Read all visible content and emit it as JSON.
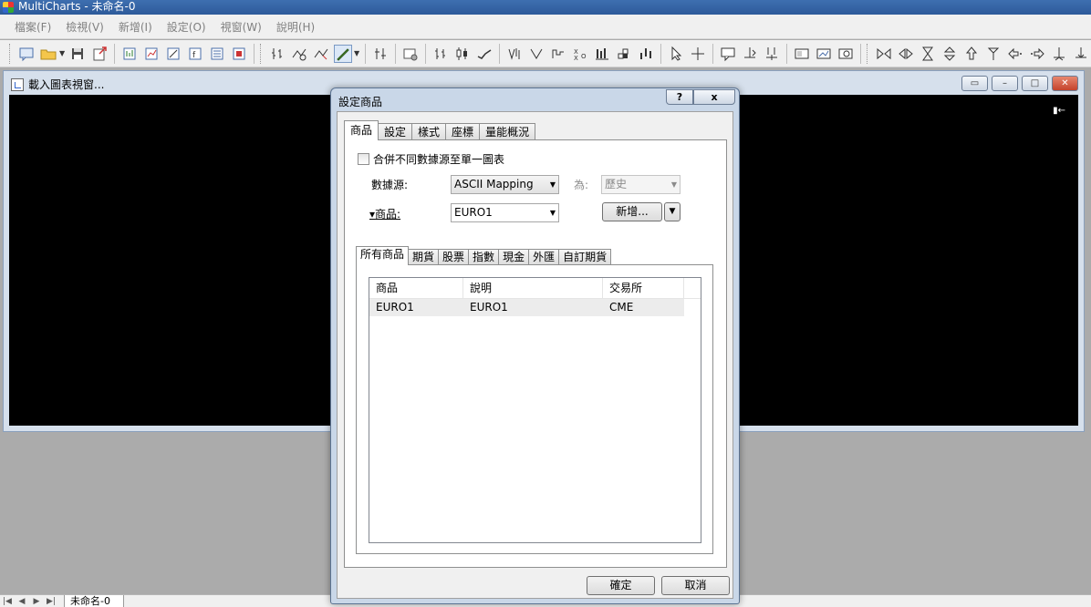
{
  "window": {
    "title": "MultiCharts - 未命名-0"
  },
  "menu": [
    "檔案(F)",
    "檢視(V)",
    "新增(I)",
    "設定(O)",
    "視窗(W)",
    "說明(H)"
  ],
  "chart_window": {
    "title": "載入圖表視窗...",
    "marker": "▮←"
  },
  "sheet": {
    "tab_label": "未命名-0"
  },
  "dialog": {
    "title": "設定商品",
    "help_label": "?",
    "close_label": "x",
    "tabs": [
      "商品",
      "設定",
      "樣式",
      "座標",
      "量能概況"
    ],
    "merge_checkbox_label": "合併不同數據源至單一圖表",
    "datasource_label": "數據源:",
    "datasource_value": "ASCII Mapping",
    "as_label": "為:",
    "as_value": "歷史",
    "symbol_label": "商品:",
    "symbol_value": "EURO1",
    "new_button": "新增...",
    "subtabs": [
      "所有商品",
      "期貨",
      "股票",
      "指數",
      "現金",
      "外匯",
      "自訂期貨"
    ],
    "table": {
      "headers": [
        "商品",
        "說明",
        "交易所"
      ],
      "rows": [
        [
          "EURO1",
          "EURO1",
          "CME"
        ]
      ]
    },
    "ok_button": "確定",
    "cancel_button": "取消"
  }
}
